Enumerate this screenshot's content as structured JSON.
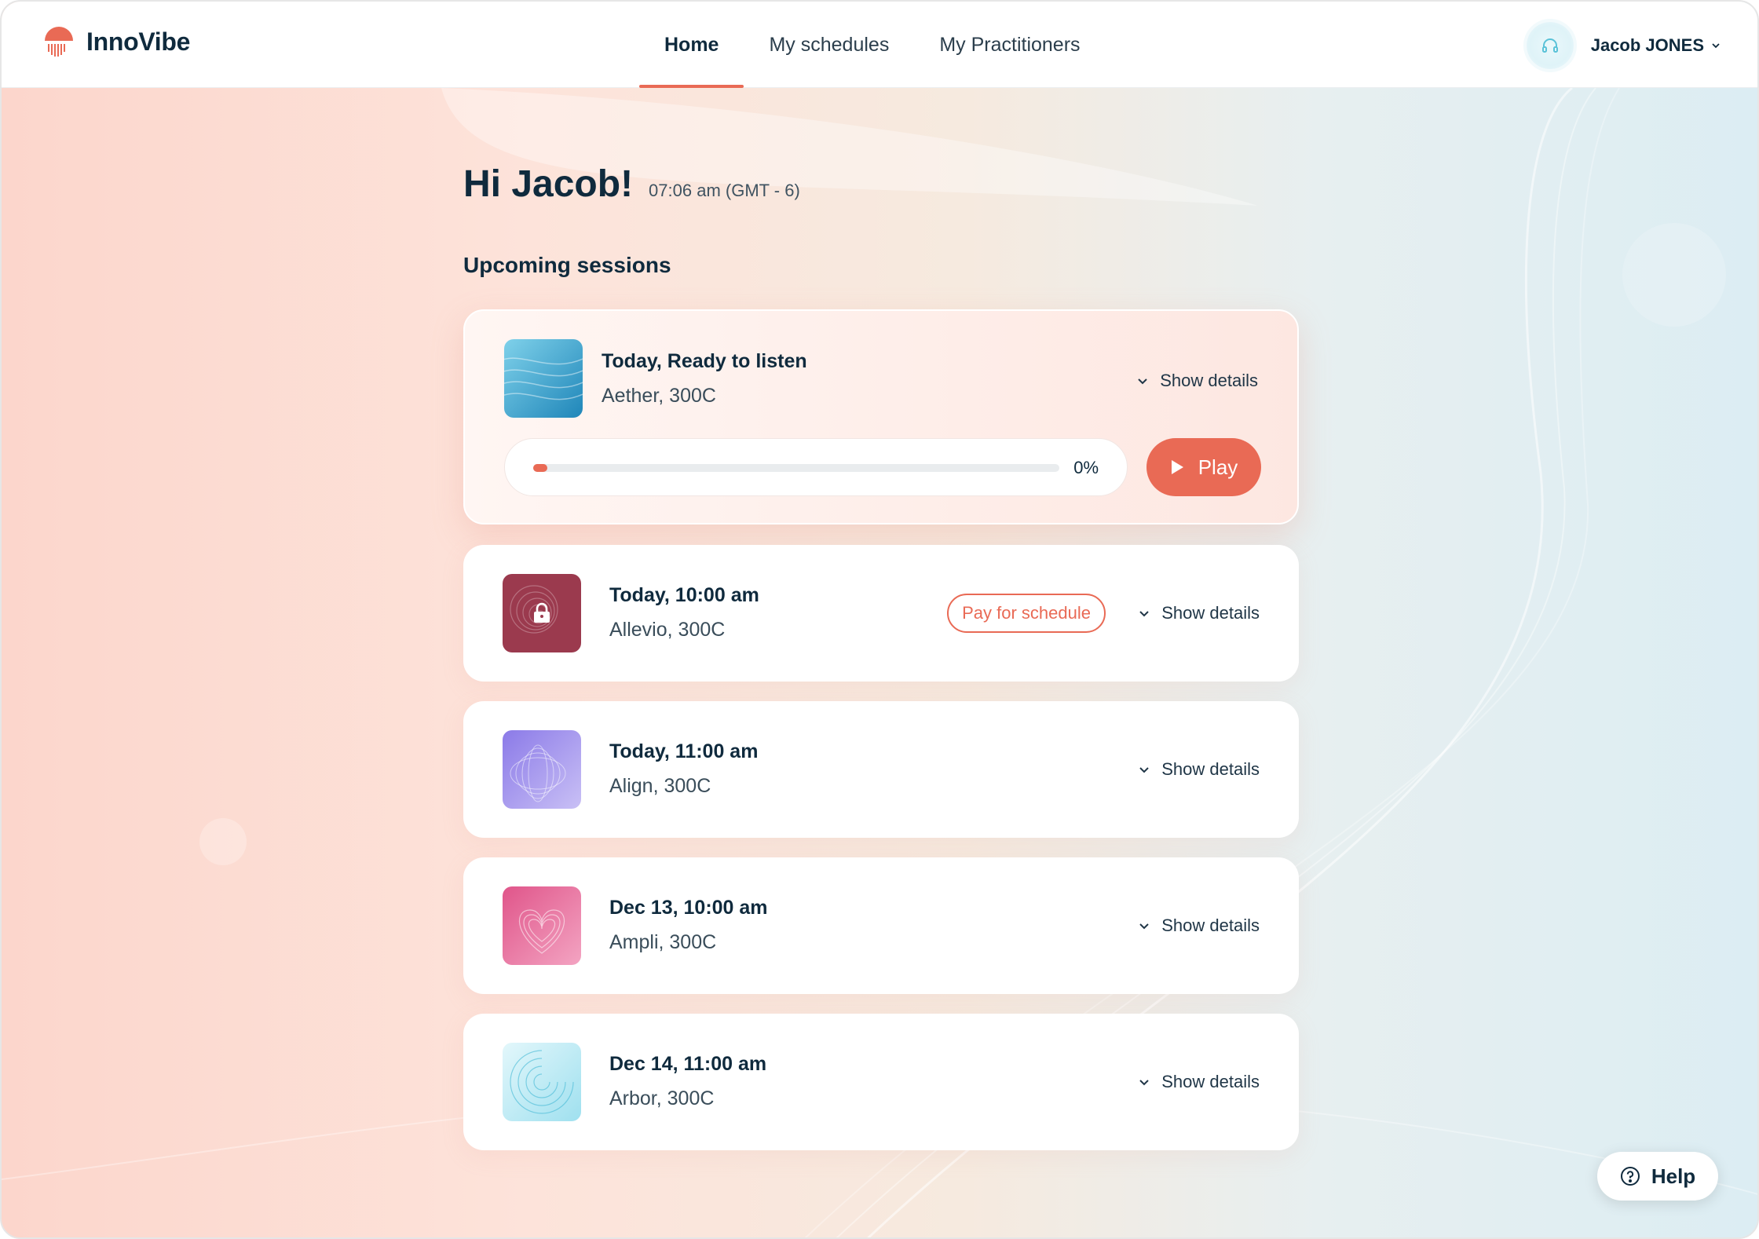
{
  "app": {
    "name": "InnoVibe"
  },
  "nav": {
    "tabs": [
      {
        "label": "Home",
        "active": true
      },
      {
        "label": "My schedules",
        "active": false
      },
      {
        "label": "My Practitioners",
        "active": false
      }
    ]
  },
  "user": {
    "name": "Jacob JONES",
    "avatar_icon": "headphones-icon"
  },
  "greeting": {
    "title": "Hi Jacob!",
    "time": "07:06 am (GMT - 6)"
  },
  "sessions": {
    "heading": "Upcoming sessions",
    "details_label": "Show details",
    "featured": {
      "when": "Today, Ready to listen",
      "what": "Aether, 300C",
      "progress_percent": 0,
      "progress_label": "0%",
      "play_label": "Play"
    },
    "items": [
      {
        "when": "Today, 10:00 am",
        "what": "Allevio, 300C",
        "pay_label": "Pay for schedule",
        "locked": true
      },
      {
        "when": "Today, 11:00 am",
        "what": "Align, 300C"
      },
      {
        "when": "Dec 13, 10:00 am",
        "what": "Ampli, 300C"
      },
      {
        "when": "Dec 14, 11:00 am",
        "what": "Arbor, 300C"
      }
    ]
  },
  "help": {
    "label": "Help"
  },
  "colors": {
    "accent": "#e96a55",
    "text_dark": "#0f2a3d"
  }
}
